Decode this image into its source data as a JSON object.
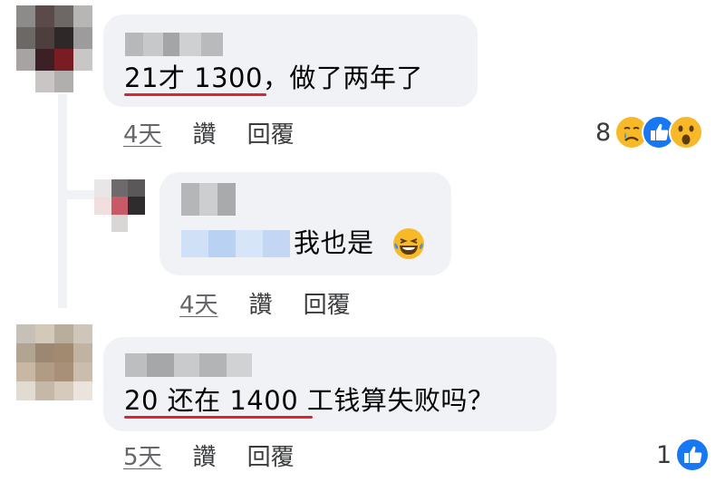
{
  "comments": [
    {
      "text": "21才 1300，做了两年了",
      "time": "4天",
      "like_label": "讚",
      "reply_label": "回覆",
      "reaction_count": "8",
      "reactions": [
        "sad-face-icon",
        "like-thumb-icon",
        "wow-face-icon"
      ]
    },
    {
      "text": "我也是",
      "time": "4天",
      "like_label": "讚",
      "reply_label": "回覆",
      "emoji": "laugh-tears-icon"
    },
    {
      "text": "20 还在 1400 工钱算失败吗？",
      "time": "5天",
      "like_label": "讚",
      "reply_label": "回覆",
      "reaction_count": "1",
      "reactions": [
        "like-thumb-icon"
      ]
    }
  ],
  "colors": {
    "bubble": "#f0f2f5",
    "underline": "#e0242e",
    "like_blue": "#1877f2",
    "reaction_yellow": "#f7b928"
  }
}
